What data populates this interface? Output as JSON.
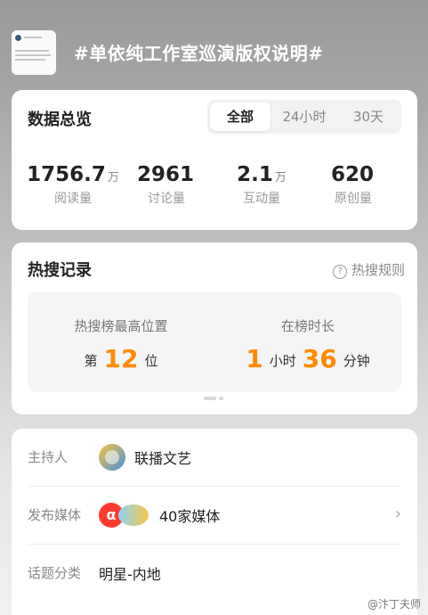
{
  "topic": {
    "title": "#单依纯工作室巡演版权说明#"
  },
  "overview": {
    "title": "数据总览",
    "tabs": [
      {
        "label": "全部",
        "active": true
      },
      {
        "label": "24小时",
        "active": false
      },
      {
        "label": "30天",
        "active": false
      }
    ],
    "stats": [
      {
        "value": "1756.7",
        "unit": "万",
        "label": "阅读量"
      },
      {
        "value": "2961",
        "unit": "",
        "label": "讨论量"
      },
      {
        "value": "2.1",
        "unit": "万",
        "label": "互动量"
      },
      {
        "value": "620",
        "unit": "",
        "label": "原创量"
      }
    ]
  },
  "hot_search": {
    "title": "热搜记录",
    "rules_label": "热搜规则",
    "rules_icon": "question-circle-icon",
    "highest": {
      "label": "热搜榜最高位置",
      "prefix": "第",
      "value": "12",
      "suffix": "位"
    },
    "duration": {
      "label": "在榜时长",
      "hours": "1",
      "hours_unit": "小时",
      "minutes": "36",
      "minutes_unit": "分钟"
    },
    "accent_color": "#ff8c00"
  },
  "info": {
    "host": {
      "label": "主持人",
      "value": "联播文艺"
    },
    "media": {
      "label": "发布媒体",
      "value": "40家媒体"
    },
    "category": {
      "label": "话题分类",
      "value": "明星-内地"
    }
  },
  "watermark": "@汴丁夫师"
}
